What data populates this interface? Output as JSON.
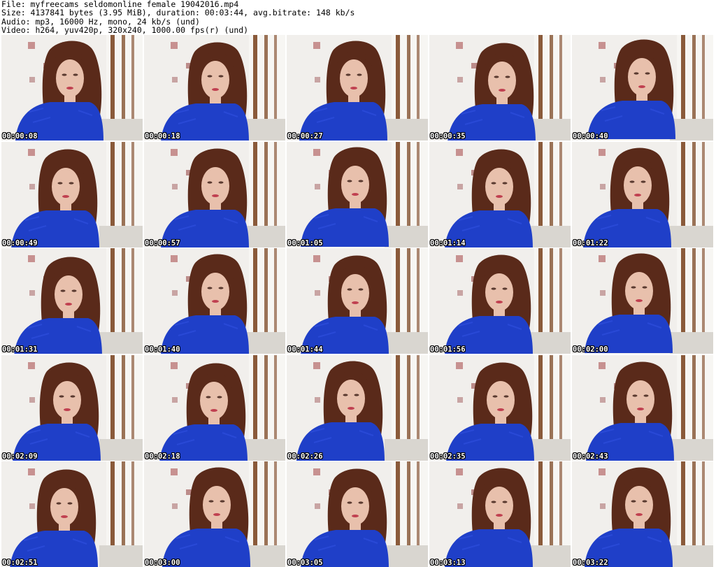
{
  "header": {
    "file": "File: myfreecams_seldomonline_female_19042016.mp4",
    "size": "Size: 4137841 bytes (3.95 MiB), duration: 00:03:44, avg.bitrate: 148 kb/s",
    "audio": "Audio: mp3, 16000 Hz, mono, 24 kb/s (und)",
    "video": "Video: h264, yuv420p, 320x240, 1000.00 fps(r) (und)"
  },
  "colors": {
    "wall": "#f1efec",
    "window_frame": "#8a5a3a",
    "hair": "#5a2a1a",
    "skin": "#e8c0ac",
    "top": "#1f3fc8",
    "lips": "#c04050"
  },
  "frames": [
    {
      "time": "00:00:08"
    },
    {
      "time": "00:00:18"
    },
    {
      "time": "00:00:27"
    },
    {
      "time": "00:00:35"
    },
    {
      "time": "00:00:40"
    },
    {
      "time": "00:00:49"
    },
    {
      "time": "00:00:57"
    },
    {
      "time": "00:01:05"
    },
    {
      "time": "00:01:14"
    },
    {
      "time": "00:01:22"
    },
    {
      "time": "00:01:31"
    },
    {
      "time": "00:01:40"
    },
    {
      "time": "00:01:44"
    },
    {
      "time": "00:01:56"
    },
    {
      "time": "00:02:00"
    },
    {
      "time": "00:02:09"
    },
    {
      "time": "00:02:18"
    },
    {
      "time": "00:02:26"
    },
    {
      "time": "00:02:35"
    },
    {
      "time": "00:02:43"
    },
    {
      "time": "00:02:51"
    },
    {
      "time": "00:03:00"
    },
    {
      "time": "00:03:05"
    },
    {
      "time": "00:03:13"
    },
    {
      "time": "00:03:22"
    }
  ]
}
